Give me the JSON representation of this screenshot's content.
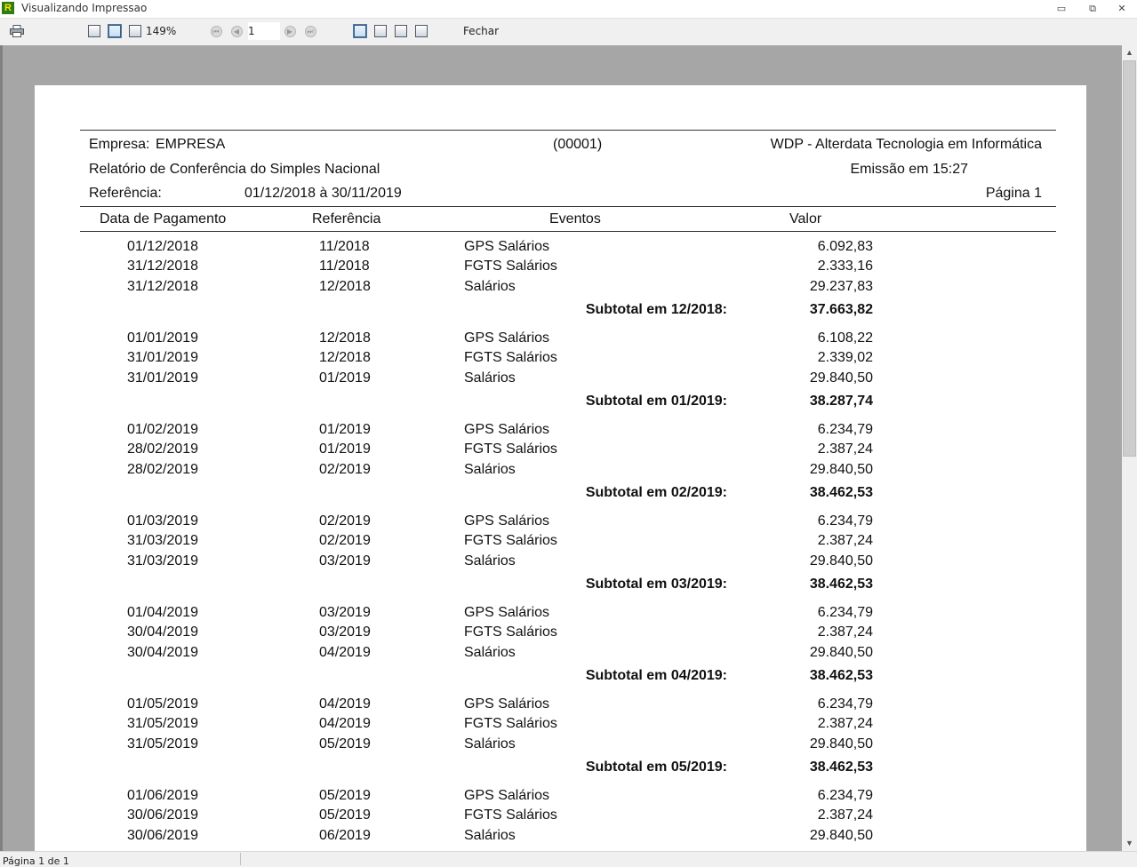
{
  "window": {
    "title": "Visualizando Impressao",
    "icon_letter": "R",
    "controls": {
      "minimize": "▭",
      "restore": "⧉",
      "close": "✕"
    }
  },
  "toolbar": {
    "zoom": "149%",
    "page_number": "1",
    "close_label": "Fechar"
  },
  "status": {
    "pages": "Página 1 de 1"
  },
  "report": {
    "empresa_label": "Empresa:",
    "empresa": "EMPRESA",
    "codigo": "(00001)",
    "company": "WDP - Alterdata Tecnologia em Informática",
    "title": "Relatório de Conferência do Simples Nacional",
    "emissao": "Emissão em 15:27",
    "referencia_label": "Referência:",
    "periodo": "01/12/2018 à 30/11/2019",
    "pagina": "Página 1",
    "columns": [
      "Data de Pagamento",
      "Referência",
      "Eventos",
      "Valor"
    ],
    "groups": [
      {
        "rows": [
          [
            "01/12/2018",
            "11/2018",
            "GPS Salários",
            "6.092,83"
          ],
          [
            "31/12/2018",
            "11/2018",
            "FGTS Salários",
            "2.333,16"
          ],
          [
            "31/12/2018",
            "12/2018",
            "Salários",
            "29.237,83"
          ]
        ],
        "subtotal_label": "Subtotal em  12/2018:",
        "subtotal": "37.663,82"
      },
      {
        "rows": [
          [
            "01/01/2019",
            "12/2018",
            "GPS Salários",
            "6.108,22"
          ],
          [
            "31/01/2019",
            "12/2018",
            "FGTS Salários",
            "2.339,02"
          ],
          [
            "31/01/2019",
            "01/2019",
            "Salários",
            "29.840,50"
          ]
        ],
        "subtotal_label": "Subtotal em  01/2019:",
        "subtotal": "38.287,74"
      },
      {
        "rows": [
          [
            "01/02/2019",
            "01/2019",
            "GPS Salários",
            "6.234,79"
          ],
          [
            "28/02/2019",
            "01/2019",
            "FGTS Salários",
            "2.387,24"
          ],
          [
            "28/02/2019",
            "02/2019",
            "Salários",
            "29.840,50"
          ]
        ],
        "subtotal_label": "Subtotal em  02/2019:",
        "subtotal": "38.462,53"
      },
      {
        "rows": [
          [
            "01/03/2019",
            "02/2019",
            "GPS Salários",
            "6.234,79"
          ],
          [
            "31/03/2019",
            "02/2019",
            "FGTS Salários",
            "2.387,24"
          ],
          [
            "31/03/2019",
            "03/2019",
            "Salários",
            "29.840,50"
          ]
        ],
        "subtotal_label": "Subtotal em  03/2019:",
        "subtotal": "38.462,53"
      },
      {
        "rows": [
          [
            "01/04/2019",
            "03/2019",
            "GPS Salários",
            "6.234,79"
          ],
          [
            "30/04/2019",
            "03/2019",
            "FGTS Salários",
            "2.387,24"
          ],
          [
            "30/04/2019",
            "04/2019",
            "Salários",
            "29.840,50"
          ]
        ],
        "subtotal_label": "Subtotal em  04/2019:",
        "subtotal": "38.462,53"
      },
      {
        "rows": [
          [
            "01/05/2019",
            "04/2019",
            "GPS Salários",
            "6.234,79"
          ],
          [
            "31/05/2019",
            "04/2019",
            "FGTS Salários",
            "2.387,24"
          ],
          [
            "31/05/2019",
            "05/2019",
            "Salários",
            "29.840,50"
          ]
        ],
        "subtotal_label": "Subtotal em  05/2019:",
        "subtotal": "38.462,53"
      },
      {
        "rows": [
          [
            "01/06/2019",
            "05/2019",
            "GPS Salários",
            "6.234,79"
          ],
          [
            "30/06/2019",
            "05/2019",
            "FGTS Salários",
            "2.387,24"
          ],
          [
            "30/06/2019",
            "06/2019",
            "Salários",
            "29.840,50"
          ]
        ],
        "subtotal_label": "",
        "subtotal": ""
      }
    ]
  }
}
